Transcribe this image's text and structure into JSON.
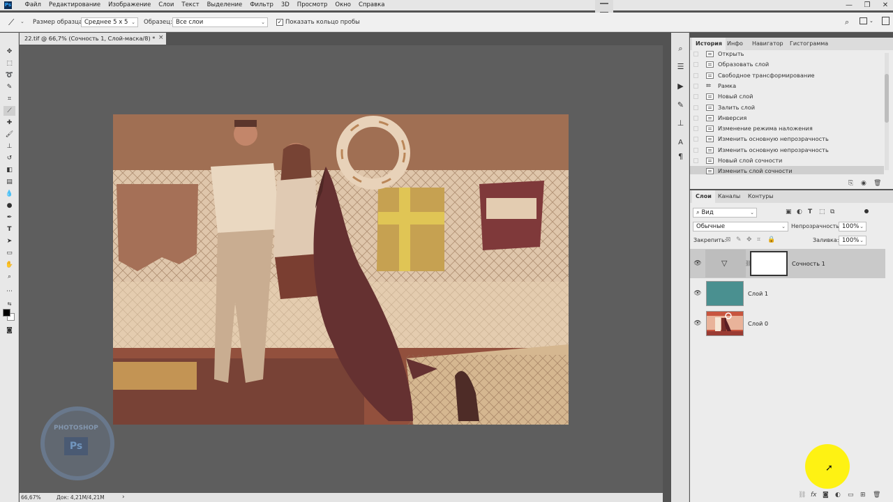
{
  "app": {
    "logo": "Ps"
  },
  "menu": [
    "Файл",
    "Редактирование",
    "Изображение",
    "Слои",
    "Текст",
    "Выделение",
    "Фильтр",
    "3D",
    "Просмотр",
    "Окно",
    "Справка"
  ],
  "window_controls": {
    "minimize": "—",
    "restore": "❐",
    "close": "✕"
  },
  "options": {
    "sample_size_label": "Размер образца:",
    "sample_size_value": "Среднее 5 x 5",
    "sample_label": "Образец:",
    "sample_value": "Все слои",
    "show_ring_label": "Показать кольцо пробы",
    "show_ring_checked": true
  },
  "document": {
    "tab_title": "22.tif @ 66,7% (Сочность 1, Слой-маска/8) *",
    "tab_close": "×"
  },
  "status": {
    "zoom": "66,67%",
    "doc_info": "Док: 4,21M/4,21M",
    "arrow": "›"
  },
  "history_panel": {
    "tabs": [
      "История",
      "Инфо",
      "Навигатор",
      "Гистограмма"
    ],
    "active_tab": 0,
    "items": [
      "Открыть",
      "Образовать слой",
      "Свободное трансформирование",
      "Рамка",
      "Новый слой",
      "Залить слой",
      "Инверсия",
      "Изменение режима наложения",
      "Изменить основную непрозрачность",
      "Изменить основную непрозрачность",
      "Новый слой сочности",
      "Изменить слой сочности"
    ],
    "selected_index": 11
  },
  "layers_panel": {
    "tabs": [
      "Слои",
      "Каналы",
      "Контуры"
    ],
    "active_tab": 0,
    "filter_value": "Вид",
    "blend_mode": "Обычные",
    "opacity_label": "Непрозрачность:",
    "opacity_value": "100%",
    "lock_label": "Закрепить:",
    "fill_label": "Заливка:",
    "fill_value": "100%",
    "layers": [
      {
        "name": "Сочность 1",
        "type": "adjustment",
        "visible": true,
        "selected": true
      },
      {
        "name": "Слой 1",
        "type": "fill",
        "color": "#4a9090",
        "visible": true,
        "selected": false
      },
      {
        "name": "Слой 0",
        "type": "image",
        "visible": true,
        "selected": false
      }
    ]
  },
  "colors": {
    "accent_yellow": "#fff200",
    "layer1_teal": "#4a9090",
    "history_selected": "#cfcfcf",
    "layer_selected": "#c9c9c9"
  },
  "watermark_text": [
    "PHOTOSHOP",
    "Ps"
  ]
}
